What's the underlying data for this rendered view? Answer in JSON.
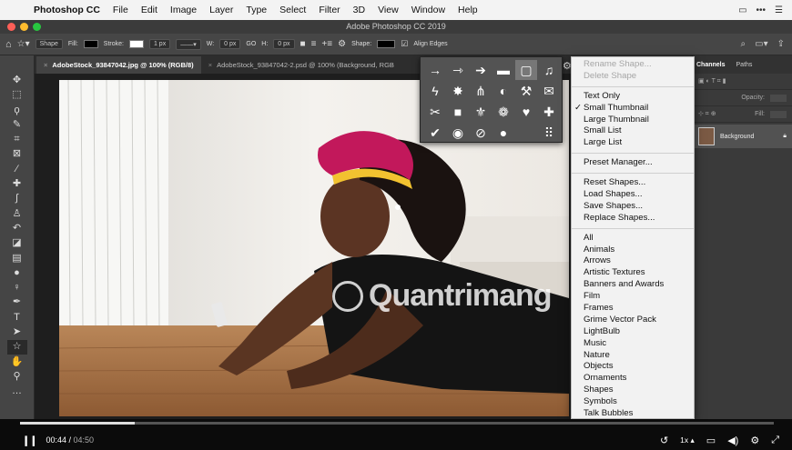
{
  "menubar": {
    "app_name": "Photoshop CC",
    "items": [
      "File",
      "Edit",
      "Image",
      "Layer",
      "Type",
      "Select",
      "Filter",
      "3D",
      "View",
      "Window",
      "Help"
    ]
  },
  "window": {
    "title": "Adobe Photoshop CC 2019"
  },
  "options": {
    "mode": "Shape",
    "fill_label": "Fill:",
    "stroke_label": "Stroke:",
    "stroke_width": "1 px",
    "width_label": "W:",
    "width_value": "0 px",
    "link": "GO",
    "height_label": "H:",
    "height_value": "0 px",
    "shape_label": "Shape:",
    "align_edges": "Align Edges",
    "fill_color": "#000000"
  },
  "tabs": [
    {
      "label": "AdobeStock_93847042.jpg @ 100% (RGB/8)",
      "close": "×"
    },
    {
      "label": "AdobeStock_93847042-2.psd @ 100% (Background, RGB",
      "close": "×"
    }
  ],
  "right_panel": {
    "tabs": [
      "Channels",
      "Paths"
    ],
    "opacity_label": "Opacity:",
    "fill_label": "Fill:",
    "layer_name": "Background"
  },
  "shape_menu": {
    "items": [
      {
        "label": "Rename Shape...",
        "disabled": true
      },
      {
        "label": "Delete Shape",
        "disabled": true
      },
      {
        "sep": true
      },
      {
        "label": "Text Only"
      },
      {
        "label": "Small Thumbnail",
        "checked": true
      },
      {
        "label": "Large Thumbnail"
      },
      {
        "label": "Small List"
      },
      {
        "label": "Large List"
      },
      {
        "sep": true
      },
      {
        "label": "Preset Manager..."
      },
      {
        "sep": true
      },
      {
        "label": "Reset Shapes..."
      },
      {
        "label": "Load Shapes..."
      },
      {
        "label": "Save Shapes..."
      },
      {
        "label": "Replace Shapes..."
      },
      {
        "sep": true
      },
      {
        "label": "All"
      },
      {
        "label": "Animals"
      },
      {
        "label": "Arrows"
      },
      {
        "label": "Artistic Textures"
      },
      {
        "label": "Banners and Awards"
      },
      {
        "label": "Film"
      },
      {
        "label": "Frames"
      },
      {
        "label": "Grime Vector Pack"
      },
      {
        "label": "LightBulb"
      },
      {
        "label": "Music"
      },
      {
        "label": "Nature"
      },
      {
        "label": "Objects"
      },
      {
        "label": "Ornaments"
      },
      {
        "label": "Shapes"
      },
      {
        "label": "Symbols"
      },
      {
        "label": "Talk Bubbles"
      }
    ]
  },
  "shape_picker": {
    "icons": [
      "arrow-1-icon",
      "arrow-2-icon",
      "arrow-3-icon",
      "banner-icon",
      "frame-icon",
      "music-note-icon",
      "lightning-icon",
      "burst-icon",
      "grass-icon",
      "lightbulb-icon",
      "tools-icon",
      "envelope-icon",
      "scissors-icon",
      "square-icon",
      "fleur-icon",
      "paw-icon",
      "heart-icon",
      "puzzle-icon",
      "checkmark-icon",
      "target-icon",
      "no-sign-icon",
      "speech-bubble-icon",
      "blank-icon",
      "grid-icon"
    ]
  },
  "watermark": {
    "text": "Quantrimang"
  },
  "video": {
    "current": "00:44",
    "duration": "04:50",
    "progress": 0.152,
    "speed": "1x"
  }
}
